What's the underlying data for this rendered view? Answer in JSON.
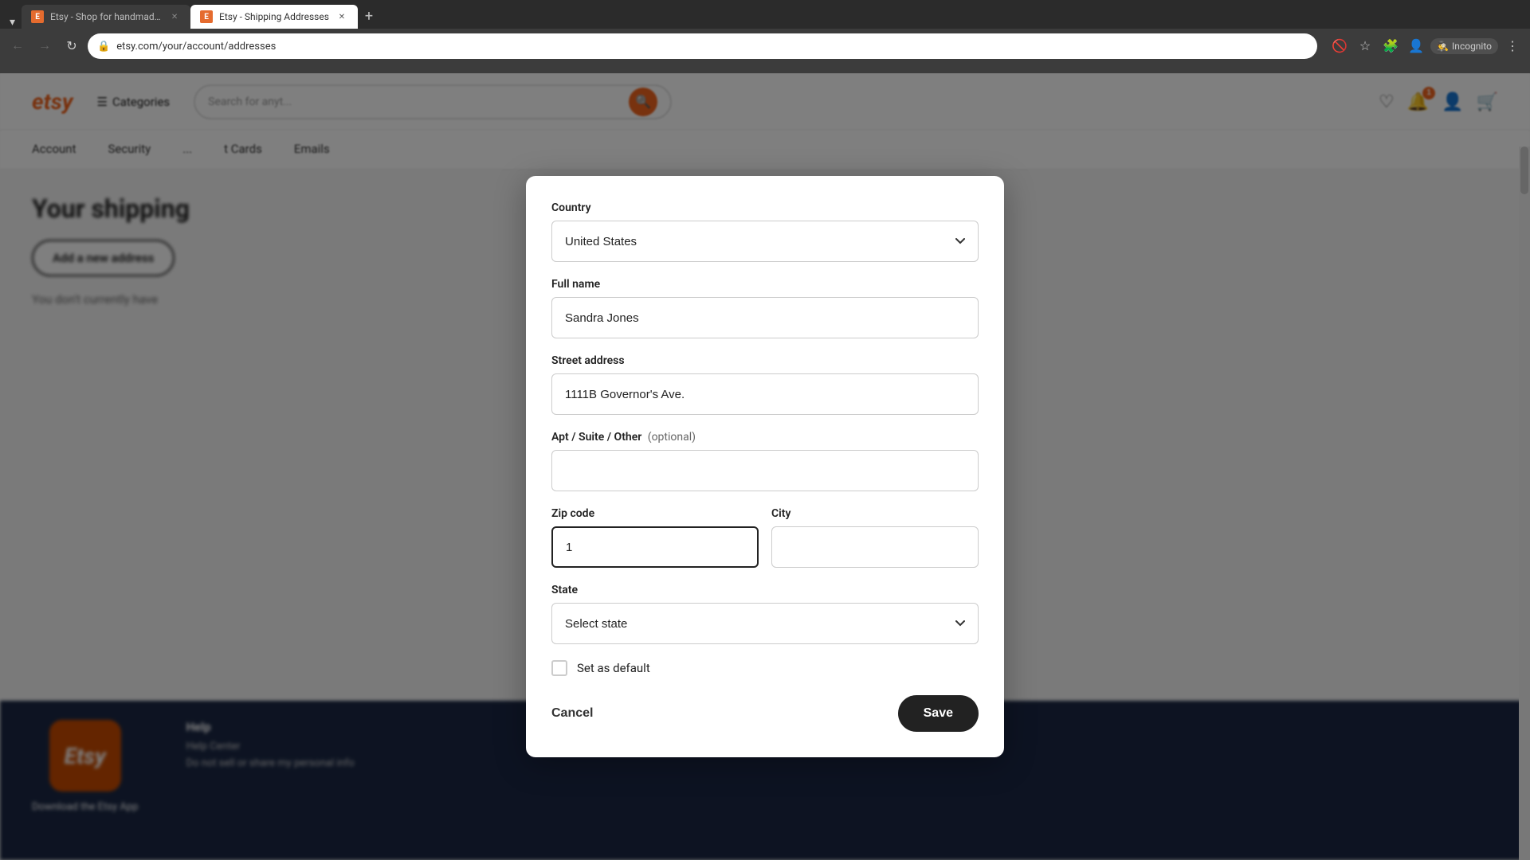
{
  "browser": {
    "tabs": [
      {
        "id": "tab1",
        "favicon": "E",
        "title": "Etsy - Shop for handmade, vint...",
        "active": false,
        "closeable": true
      },
      {
        "id": "tab2",
        "favicon": "E",
        "title": "Etsy - Shipping Addresses",
        "active": true,
        "closeable": true
      }
    ],
    "new_tab_label": "+",
    "nav": {
      "back_title": "Back",
      "forward_title": "Forward",
      "reload_title": "Reload",
      "url": "etsy.com/your/account/addresses"
    },
    "toolbar": {
      "profile_icon": "👤",
      "incognito_label": "Incognito"
    }
  },
  "etsy_header": {
    "logo": "etsy",
    "categories_label": "Categories",
    "search_placeholder": "Search for anyt...",
    "nav_items": [
      "Account",
      "Security",
      "...",
      "t Cards",
      "Emails"
    ]
  },
  "page": {
    "title": "Your shipping",
    "add_address_btn": "Add a new address",
    "empty_state": "You don't currently have"
  },
  "modal": {
    "country_label": "Country",
    "country_value": "United States",
    "country_placeholder": "United States",
    "fullname_label": "Full name",
    "fullname_value": "Sandra Jones",
    "street_label": "Street address",
    "street_value": "1111B Governor's Ave.",
    "apt_label": "Apt / Suite / Other",
    "apt_optional_text": "(optional)",
    "apt_value": "",
    "apt_placeholder": "",
    "zip_label": "Zip code",
    "zip_value": "1",
    "city_label": "City",
    "city_value": "",
    "state_label": "State",
    "state_placeholder": "Select state",
    "state_value": "",
    "default_label": "Set as default",
    "cancel_btn": "Cancel",
    "save_btn": "Save"
  },
  "footer": {
    "app_logo": "Etsy",
    "download_label": "Download the Etsy App",
    "help_title": "Help",
    "help_center": "Help Center",
    "privacy_link": "Do not sell or share my personal info"
  },
  "colors": {
    "etsy_orange": "#f1641e",
    "etsy_dark": "#222222",
    "modal_bg": "#ffffff",
    "overlay_bg": "rgba(0,0,0,0.5)"
  }
}
